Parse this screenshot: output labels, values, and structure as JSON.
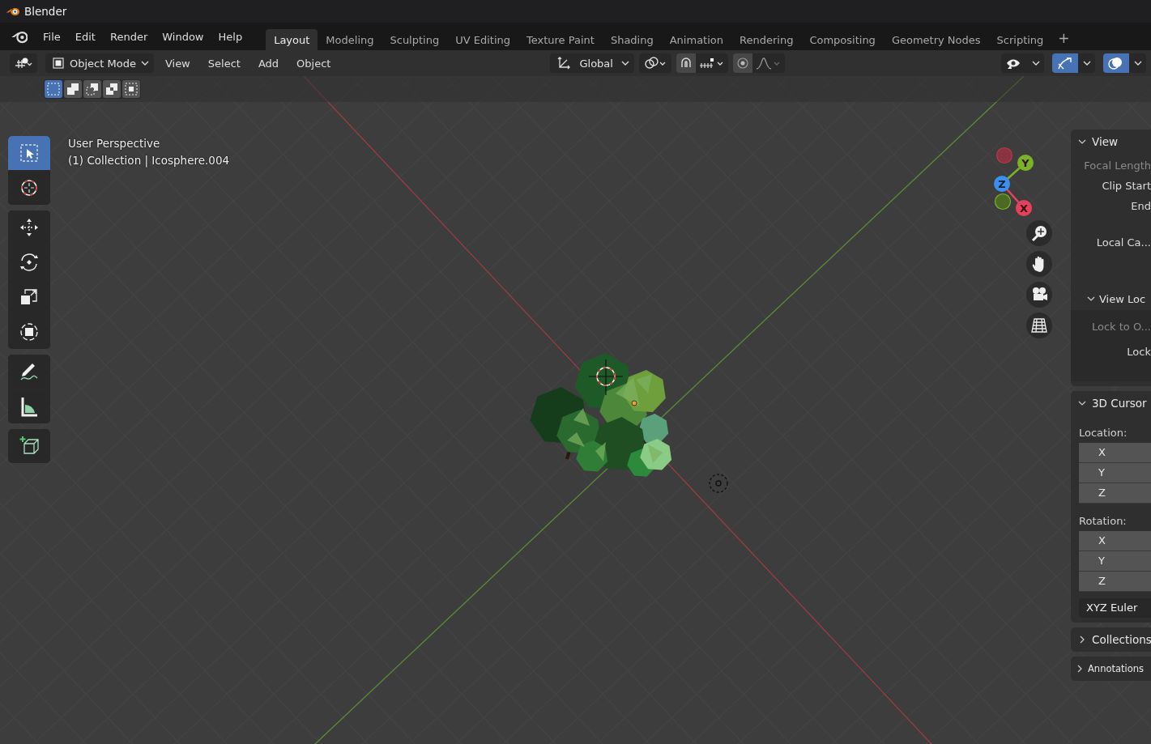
{
  "window": {
    "title": "Blender"
  },
  "menu": [
    "File",
    "Edit",
    "Render",
    "Window",
    "Help"
  ],
  "workspaces": [
    {
      "label": "Layout",
      "selected": true
    },
    {
      "label": "Modeling",
      "selected": false
    },
    {
      "label": "Sculpting",
      "selected": false
    },
    {
      "label": "UV Editing",
      "selected": false
    },
    {
      "label": "Texture Paint",
      "selected": false
    },
    {
      "label": "Shading",
      "selected": false
    },
    {
      "label": "Animation",
      "selected": false
    },
    {
      "label": "Rendering",
      "selected": false
    },
    {
      "label": "Compositing",
      "selected": false
    },
    {
      "label": "Geometry Nodes",
      "selected": false
    },
    {
      "label": "Scripting",
      "selected": false
    }
  ],
  "add_workspace": "+",
  "header": {
    "mode": "Object Mode",
    "menus": [
      "View",
      "Select",
      "Add",
      "Object"
    ],
    "orientation": "Global",
    "toggles": [
      {
        "kind": "visibility",
        "on": false
      },
      {
        "kind": "gizmos",
        "on": true
      },
      {
        "kind": "overlays",
        "on": true
      }
    ]
  },
  "select_modes": [
    {
      "kind": "set",
      "selected": true
    },
    {
      "kind": "extend",
      "selected": false
    },
    {
      "kind": "subtract",
      "selected": false
    },
    {
      "kind": "difference",
      "selected": false
    },
    {
      "kind": "intersect",
      "selected": false
    }
  ],
  "tool_groups": [
    {
      "tools": [
        {
          "kind": "select_box",
          "selected": true
        },
        {
          "kind": "cursor",
          "selected": false
        }
      ]
    },
    {
      "tools": [
        {
          "kind": "move",
          "selected": false
        },
        {
          "kind": "rotate",
          "selected": false
        },
        {
          "kind": "scale",
          "selected": false
        },
        {
          "kind": "transform",
          "selected": false
        }
      ]
    },
    {
      "tools": [
        {
          "kind": "annotate",
          "selected": false
        },
        {
          "kind": "measure",
          "selected": false
        }
      ]
    },
    {
      "tools": [
        {
          "kind": "add_cube",
          "selected": false
        }
      ]
    }
  ],
  "viewport": {
    "overlay_text": [
      "User Perspective",
      "(1) Collection | Icosphere.004"
    ],
    "axes": [
      {
        "label": "Y",
        "kind": "y"
      },
      {
        "label": "Z",
        "kind": "z"
      },
      {
        "label": "X",
        "kind": "x"
      }
    ],
    "nav_buttons": [
      {
        "kind": "zoom"
      },
      {
        "kind": "pan"
      },
      {
        "kind": "camera"
      },
      {
        "kind": "ortho"
      }
    ]
  },
  "sidebar": {
    "panels": [
      {
        "title": "View",
        "expanded": true,
        "rows": [
          {
            "kind": "label",
            "text": "Focal Length",
            "disabled": true
          },
          {
            "kind": "label",
            "text": "Clip Start",
            "disabled": false
          },
          {
            "kind": "label",
            "text": "End",
            "disabled": false
          },
          {
            "kind": "label",
            "text": "Local Ca...",
            "disabled": false
          }
        ],
        "subpanels": [
          {
            "title": "View Loc",
            "expanded": true,
            "rows": [
              {
                "kind": "label",
                "text": "Lock to O...",
                "disabled": true
              },
              {
                "kind": "label",
                "text": "Lock",
                "disabled": false
              }
            ]
          }
        ]
      },
      {
        "title": "3D Cursor",
        "expanded": true,
        "rows": [
          {
            "kind": "heading",
            "text": "Location:"
          },
          {
            "kind": "field",
            "text": "X"
          },
          {
            "kind": "field",
            "text": "Y"
          },
          {
            "kind": "field",
            "text": "Z"
          },
          {
            "kind": "heading",
            "text": "Rotation:"
          },
          {
            "kind": "field",
            "text": "X"
          },
          {
            "kind": "field",
            "text": "Y"
          },
          {
            "kind": "field",
            "text": "Z"
          },
          {
            "kind": "dropdown",
            "text": "XYZ Euler"
          }
        ]
      },
      {
        "title": "Collections",
        "expanded": false
      },
      {
        "title": "Annotations",
        "expanded": false
      }
    ]
  }
}
